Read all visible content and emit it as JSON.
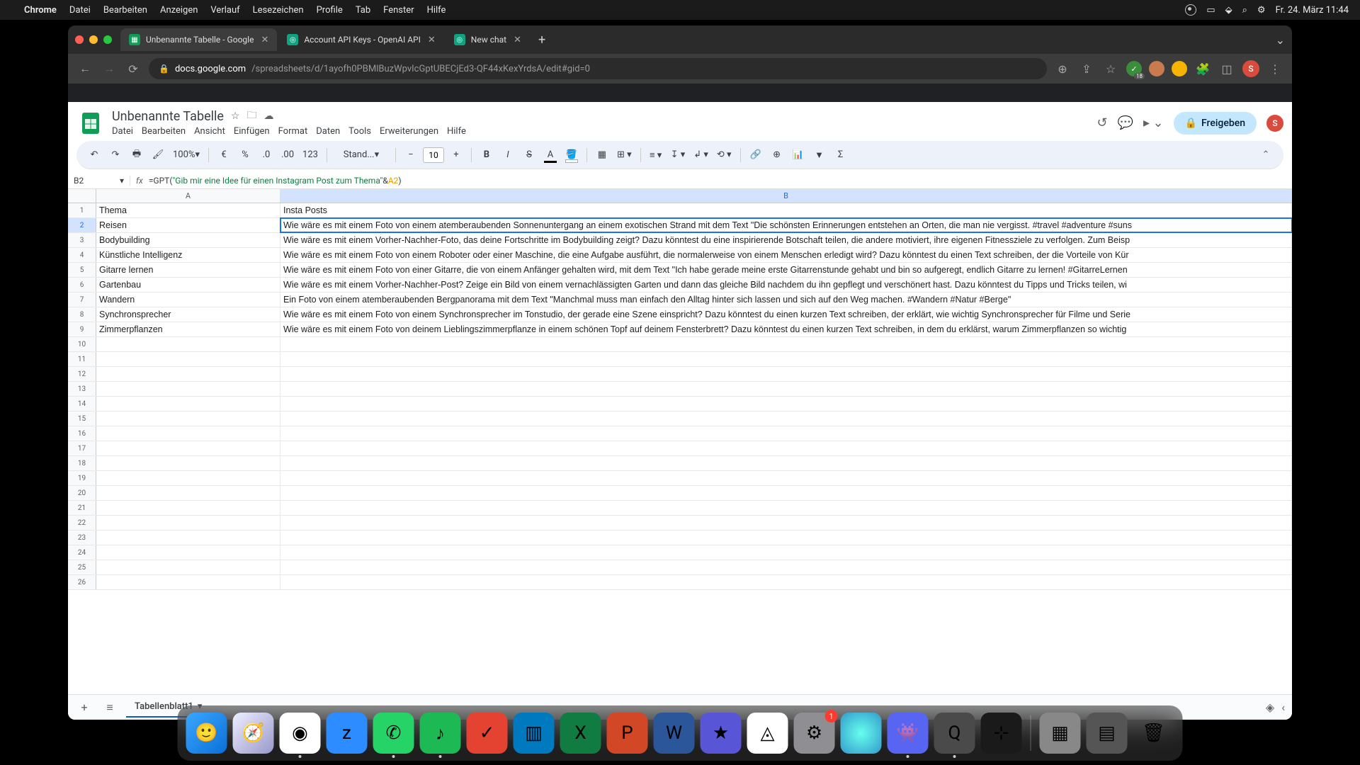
{
  "macos": {
    "app_name": "Chrome",
    "menus": [
      "Datei",
      "Bearbeiten",
      "Anzeigen",
      "Verlauf",
      "Lesezeichen",
      "Profile",
      "Tab",
      "Fenster",
      "Hilfe"
    ],
    "clock": "Fr. 24. März 11:44"
  },
  "browser": {
    "tabs": [
      {
        "title": "Unbenannte Tabelle - Google",
        "active": true
      },
      {
        "title": "Account API Keys - OpenAI API",
        "active": false
      },
      {
        "title": "New chat",
        "active": false
      }
    ],
    "url_host": "docs.google.com",
    "url_path": "/spreadsheets/d/1ayofh0PBMlBuzWpvIcGptUBECjEd3-QF44xKexYrdsA/edit#gid=0",
    "profile_initial": "S",
    "ext_badge": "18"
  },
  "sheets": {
    "doc_title": "Unbenannte Tabelle",
    "menus": [
      "Datei",
      "Bearbeiten",
      "Ansicht",
      "Einfügen",
      "Format",
      "Daten",
      "Tools",
      "Erweiterungen",
      "Hilfe"
    ],
    "share_label": "Freigeben",
    "zoom": "100%",
    "font": "Stand...",
    "font_size": "10",
    "name_box": "B2",
    "formula_prefix": "=GPT(",
    "formula_string": "\"Gib mir eine Idee für einen Instagram Post zum Thema\"",
    "formula_mid": " & ",
    "formula_ref": "A2",
    "formula_suffix": ")",
    "sheet_tab": "Tabellenblatt1",
    "columns": [
      "A",
      "B"
    ],
    "rows": [
      {
        "n": 1,
        "a": "Thema",
        "b": "Insta Posts"
      },
      {
        "n": 2,
        "a": "Reisen",
        "b": "Wie wäre es mit einem Foto von einem atemberaubenden Sonnenuntergang an einem exotischen Strand mit dem Text \"Die schönsten Erinnerungen entstehen an Orten, die man nie vergisst. #travel #adventure #suns",
        "selected": true
      },
      {
        "n": 3,
        "a": "Bodybuilding",
        "b": "Wie wäre es mit einem Vorher-Nachher-Foto, das deine Fortschritte im Bodybuilding zeigt? Dazu könntest du eine inspirierende Botschaft teilen, die andere motiviert, ihre eigenen Fitnessziele zu verfolgen. Zum Beisp"
      },
      {
        "n": 4,
        "a": "Künstliche Intelligenz",
        "b": "Wie wäre es mit einem Foto von einem Roboter oder einer Maschine, die eine Aufgabe ausführt, die normalerweise von einem Menschen erledigt wird? Dazu könntest du einen Text schreiben, der die Vorteile von Kür"
      },
      {
        "n": 5,
        "a": "Gitarre lernen",
        "b": "Wie wäre es mit einem Foto von einer Gitarre, die von einem Anfänger gehalten wird, mit dem Text \"Ich habe gerade meine erste Gitarrenstunde gehabt und bin so aufgeregt, endlich Gitarre zu lernen! #GitarreLernen"
      },
      {
        "n": 6,
        "a": "Gartenbau",
        "b": "Wie wäre es mit einem Vorher-Nachher-Post? Zeige ein Bild von einem vernachlässigten Garten und dann das gleiche Bild nachdem du ihn gepflegt und verschönert hast. Dazu könntest du Tipps und Tricks teilen, wi"
      },
      {
        "n": 7,
        "a": "Wandern",
        "b": "Ein Foto von einem atemberaubenden Bergpanorama mit dem Text \"Manchmal muss man einfach den Alltag hinter sich lassen und sich auf den Weg machen. #Wandern #Natur #Berge\""
      },
      {
        "n": 8,
        "a": "Synchronsprecher",
        "b": "Wie wäre es mit einem Foto von einem Synchronsprecher im Tonstudio, der gerade eine Szene einspricht? Dazu könntest du einen kurzen Text schreiben, der erklärt, wie wichtig Synchronsprecher für Filme und Serie"
      },
      {
        "n": 9,
        "a": "Zimmerpflanzen",
        "b": "Wie wäre es mit einem Foto von deinem Lieblingszimmerpflanze in einem schönen Topf auf deinem Fensterbrett? Dazu könntest du einen kurzen Text schreiben, in dem du erklärst, warum Zimmerpflanzen so wichtig"
      }
    ],
    "empty_rows": [
      10,
      11,
      12,
      13,
      14,
      15,
      16,
      17,
      18,
      19,
      20,
      21,
      22,
      23,
      24,
      25,
      26
    ]
  },
  "dock": {
    "items": [
      {
        "name": "finder",
        "bg": "linear-gradient(135deg,#3ba7ff,#0a6fd8)",
        "glyph": "🙂"
      },
      {
        "name": "safari",
        "bg": "linear-gradient(135deg,#eef,#99c)",
        "glyph": "🧭"
      },
      {
        "name": "chrome",
        "bg": "#fff",
        "glyph": "◉",
        "dot": true
      },
      {
        "name": "zoom",
        "bg": "#2d8cff",
        "glyph": "z"
      },
      {
        "name": "whatsapp",
        "bg": "#25d366",
        "glyph": "✆",
        "dot": true
      },
      {
        "name": "spotify",
        "bg": "#1db954",
        "glyph": "♪",
        "dot": true
      },
      {
        "name": "todoist",
        "bg": "#e44332",
        "glyph": "✓"
      },
      {
        "name": "trello",
        "bg": "#0079bf",
        "glyph": "▥"
      },
      {
        "name": "excel",
        "bg": "#107c41",
        "glyph": "X"
      },
      {
        "name": "powerpoint",
        "bg": "#d24726",
        "glyph": "P"
      },
      {
        "name": "word",
        "bg": "#2b579a",
        "glyph": "W"
      },
      {
        "name": "imovie",
        "bg": "#5856d6",
        "glyph": "★"
      },
      {
        "name": "drive",
        "bg": "#fff",
        "glyph": "◬"
      },
      {
        "name": "settings",
        "bg": "#8e8e93",
        "glyph": "⚙",
        "badge": "1"
      },
      {
        "name": "siri",
        "bg": "radial-gradient(circle,#6fe,#39c)",
        "glyph": ""
      },
      {
        "name": "discord",
        "bg": "#5865f2",
        "glyph": "👾",
        "dot": true
      },
      {
        "name": "quicktime",
        "bg": "#4a4a4a",
        "glyph": "Q",
        "dot": true
      },
      {
        "name": "audio",
        "bg": "#1a1a1a",
        "glyph": "⊹"
      }
    ],
    "right": [
      {
        "name": "screens",
        "bg": "#888",
        "glyph": "▦"
      },
      {
        "name": "mission",
        "bg": "#555",
        "glyph": "▤"
      },
      {
        "name": "trash",
        "bg": "transparent",
        "glyph": "🗑"
      }
    ]
  }
}
